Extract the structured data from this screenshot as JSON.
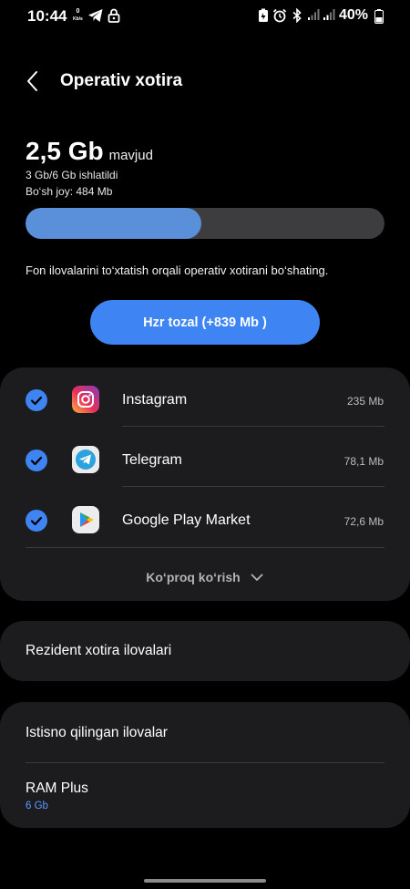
{
  "status_bar": {
    "time": "10:44",
    "speed_value": "0",
    "speed_unit": "Kb/s",
    "battery_percent": "40%"
  },
  "header": {
    "title": "Operativ xotira"
  },
  "memory": {
    "available_value": "2,5 Gb",
    "available_suffix": "mavjud",
    "used_text": "3 Gb/6 Gb ishlatildi",
    "free_text": "Bo‘sh joy: 484 Mb",
    "used_fraction": 0.49
  },
  "hint_text": "Fon ilovalarini to‘xtatish orqali operativ xotirani bo‘shating.",
  "clean_button_label": "Hzr tozal (+839 Mb )",
  "apps": [
    {
      "name": "Instagram",
      "size": "235 Mb",
      "icon": "instagram-icon"
    },
    {
      "name": "Telegram",
      "size": "78,1 Mb",
      "icon": "telegram-icon"
    },
    {
      "name": "Google Play Market",
      "size": "72,6 Mb",
      "icon": "google-play-icon"
    }
  ],
  "more_label": "Ko‘proq ko‘rish",
  "resident_label": "Rezident xotira ilovalari",
  "excluded_label": "Istisno qilingan ilovalar",
  "ram_plus": {
    "label": "RAM Plus",
    "value": "6 Gb"
  },
  "colors": {
    "accent": "#3e84f3",
    "progress_fill": "#5a8fd9",
    "link_value": "#5c9bff",
    "card_bg": "#1c1c1e"
  }
}
